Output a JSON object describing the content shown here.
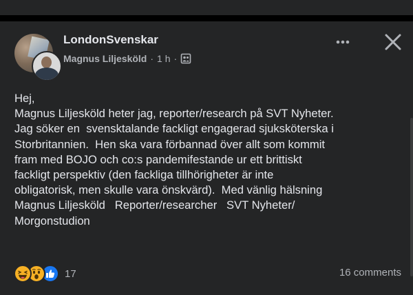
{
  "post": {
    "group_name": "LondonSvenskar",
    "author": "Magnus Liljesköld",
    "separator": "·",
    "time": "1 h",
    "body": "Hej,\nMagnus Liljesköld heter jag, reporter/research på SVT Nyheter.\nJag söker en  svensktalande fackligt engagerad sjuksköterska i\nStorbritannien.  Hen ska vara förbannad över allt som kommit\nfram med BOJO och co:s pandemifestande ur ett brittiskt\nfackligt perspektiv (den fackliga tillhörigheter är inte\nobligatorisk, men skulle vara önskvärd).  Med vänlig hälsning\nMagnus Liljesköld   Reporter/researcher   SVT Nyheter/\nMorgonstudion",
    "reaction_count": "17",
    "comments": "16 comments"
  },
  "icons": {
    "more": "more-options-icon",
    "close": "close-icon",
    "audience": "group-audience-icon",
    "reactions": [
      "haha-reaction-icon",
      "wow-reaction-icon",
      "like-reaction-icon"
    ]
  },
  "colors": {
    "background": "#000000",
    "card": "#242526",
    "primary_text": "#e4e6eb",
    "secondary_text": "#b0b3b8",
    "like_blue": "#1877f2",
    "reaction_yellow": "#f7b125"
  }
}
